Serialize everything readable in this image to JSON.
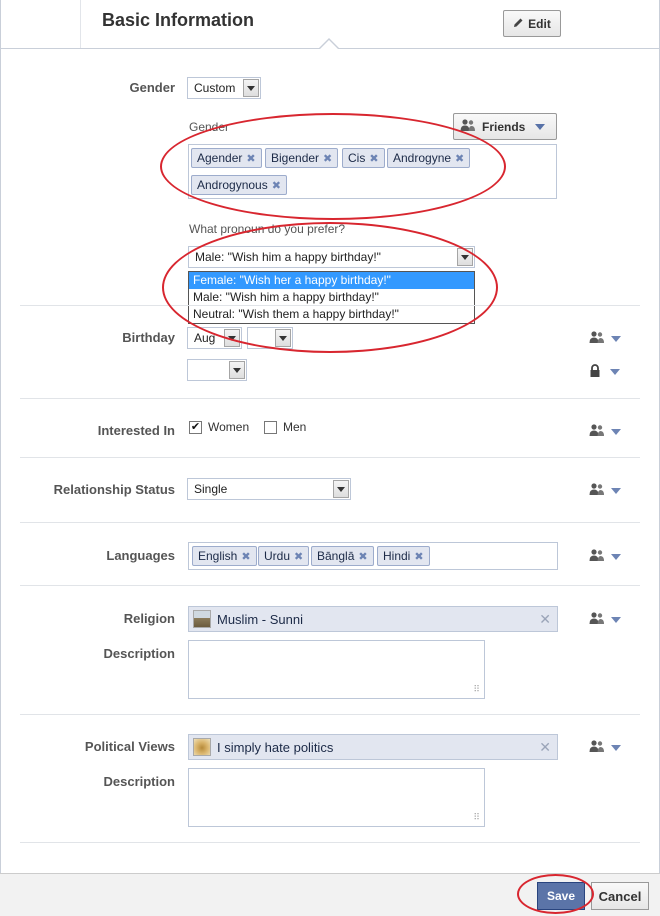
{
  "header": {
    "title": "Basic Information",
    "edit_label": "Edit"
  },
  "gender": {
    "label": "Gender",
    "select_value": "Custom",
    "custom_label": "Gender",
    "audience_label": "Friends",
    "tokens": [
      "Agender",
      "Bigender",
      "Cis",
      "Androgyne",
      "Androgynous"
    ],
    "pronoun_question": "What pronoun do you prefer?",
    "pronoun_selected": "Male: \"Wish him a happy birthday!\"",
    "pronoun_options": [
      "Female: \"Wish her a happy birthday!\"",
      "Male: \"Wish him a happy birthday!\"",
      "Neutral: \"Wish them a happy birthday!\""
    ]
  },
  "birthday": {
    "label": "Birthday",
    "month": "Aug",
    "day": "",
    "year": ""
  },
  "interested_in": {
    "label": "Interested In",
    "options": [
      "Women",
      "Men"
    ],
    "checked": [
      true,
      false
    ]
  },
  "relationship": {
    "label": "Relationship Status",
    "value": "Single"
  },
  "languages": {
    "label": "Languages",
    "tokens": [
      "English",
      "Urdu",
      "Bānglā",
      "Hindi"
    ]
  },
  "religion": {
    "label": "Religion",
    "value": "Muslim - Sunni",
    "description_label": "Description",
    "description_value": ""
  },
  "political": {
    "label": "Political Views",
    "value": "I simply hate politics",
    "description_label": "Description",
    "description_value": ""
  },
  "footer": {
    "save_label": "Save",
    "cancel_label": "Cancel"
  },
  "colors": {
    "annotation": "#d8262f",
    "accent": "#5b74a8",
    "token_bg": "#e2e6f0",
    "selected_option": "#3399ff"
  },
  "icons": {
    "edit": "pencil-icon",
    "audience": "people-icon",
    "lock": "lock-icon",
    "remove": "close-icon"
  }
}
